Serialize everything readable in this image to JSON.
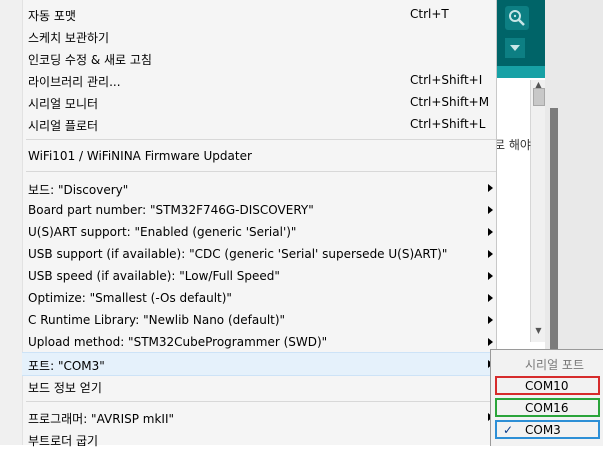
{
  "ide": {
    "code_fragment": "로 해야"
  },
  "menu": {
    "items": [
      {
        "label": "자동 포맷",
        "shortcut": "Ctrl+T"
      },
      {
        "label": "스케치 보관하기",
        "shortcut": ""
      },
      {
        "label": "인코딩 수정 & 새로 고침",
        "shortcut": ""
      },
      {
        "label": "라이브러리 관리...",
        "shortcut": "Ctrl+Shift+I"
      },
      {
        "label": "시리얼 모니터",
        "shortcut": "Ctrl+Shift+M"
      },
      {
        "label": "시리얼 플로터",
        "shortcut": "Ctrl+Shift+L"
      },
      {
        "label": "WiFi101 / WiFiNINA Firmware Updater",
        "shortcut": ""
      },
      {
        "label": "보드: \"Discovery\"",
        "submenu": true
      },
      {
        "label": "Board part number: \"STM32F746G-DISCOVERY\"",
        "submenu": true
      },
      {
        "label": "U(S)ART support: \"Enabled (generic 'Serial')\"",
        "submenu": true
      },
      {
        "label": "USB support (if available): \"CDC (generic 'Serial' supersede U(S)ART)\"",
        "submenu": true
      },
      {
        "label": "USB speed (if available): \"Low/Full Speed\"",
        "submenu": true
      },
      {
        "label": "Optimize: \"Smallest (-Os default)\"",
        "submenu": true
      },
      {
        "label": "C Runtime Library: \"Newlib Nano (default)\"",
        "submenu": true
      },
      {
        "label": "Upload method: \"STM32CubeProgrammer (SWD)\"",
        "submenu": true
      },
      {
        "label": "포트: \"COM3\"",
        "submenu": true,
        "highlighted": true
      },
      {
        "label": "보드 정보 얻기",
        "shortcut": ""
      },
      {
        "label": "프로그래머: \"AVRISP mkII\"",
        "submenu": true
      },
      {
        "label": "부트로더 굽기",
        "shortcut": ""
      }
    ]
  },
  "port_submenu": {
    "header": "시리얼 포트",
    "ports": [
      {
        "label": "COM10",
        "outline": "#d62b2b",
        "checked": false
      },
      {
        "label": "COM16",
        "outline": "#2aa43a",
        "checked": false
      },
      {
        "label": "COM3",
        "outline": "#2d8fd6",
        "checked": true
      }
    ],
    "check_glyph": "✓"
  },
  "colors": {
    "toolbar": "#006468",
    "highlight": "#e5f1fb"
  }
}
